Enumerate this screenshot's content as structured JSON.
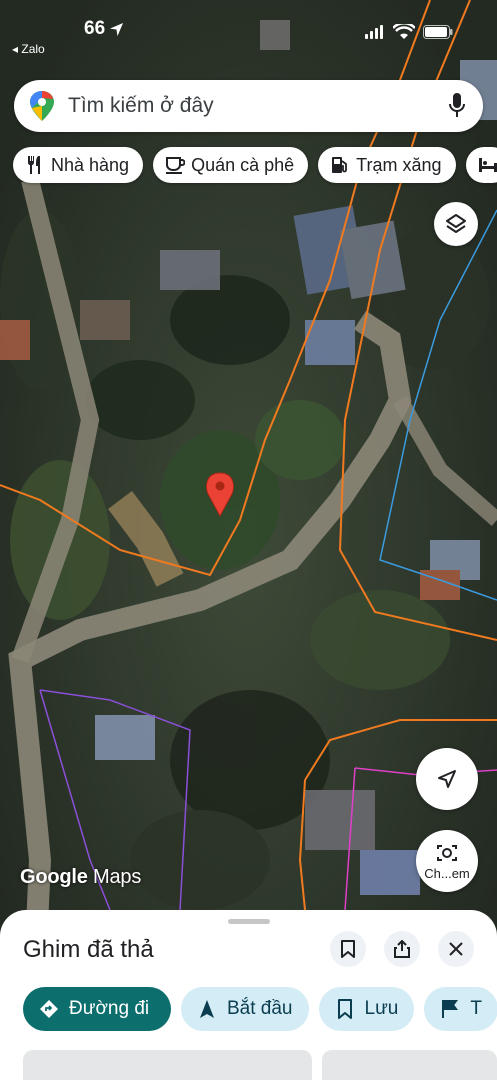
{
  "status_bar": {
    "time": "66",
    "back_app": "◂ Zalo"
  },
  "search": {
    "placeholder": "Tìm kiếm ở đây",
    "icons": [
      "google-maps-pin-icon",
      "microphone-icon"
    ]
  },
  "chips": [
    {
      "label": "Nhà hàng",
      "icon": "restaurant-icon"
    },
    {
      "label": "Quán cà phê",
      "icon": "coffee-icon"
    },
    {
      "label": "Trạm xăng",
      "icon": "gas-station-icon"
    }
  ],
  "map": {
    "watermark_brand": "Google",
    "watermark_product": "Maps",
    "lens_label": "Ch...em",
    "pin_color": "#ea4335"
  },
  "sheet": {
    "title": "Ghim đã thả",
    "actions": [
      {
        "label": "Đường đi",
        "icon": "directions-icon"
      },
      {
        "label": "Bắt đầu",
        "icon": "navigation-arrow-icon"
      },
      {
        "label": "Lưu",
        "icon": "bookmark-icon"
      },
      {
        "label": "T",
        "icon": "flag-icon"
      }
    ]
  },
  "colors": {
    "primary_action": "#0d6e6e",
    "secondary_action": "#d3ecf5",
    "parcel_line": "#f07a1f",
    "boundary_blue": "#3b9be0",
    "boundary_purple": "#8a4fd8",
    "boundary_magenta": "#e040c8"
  }
}
